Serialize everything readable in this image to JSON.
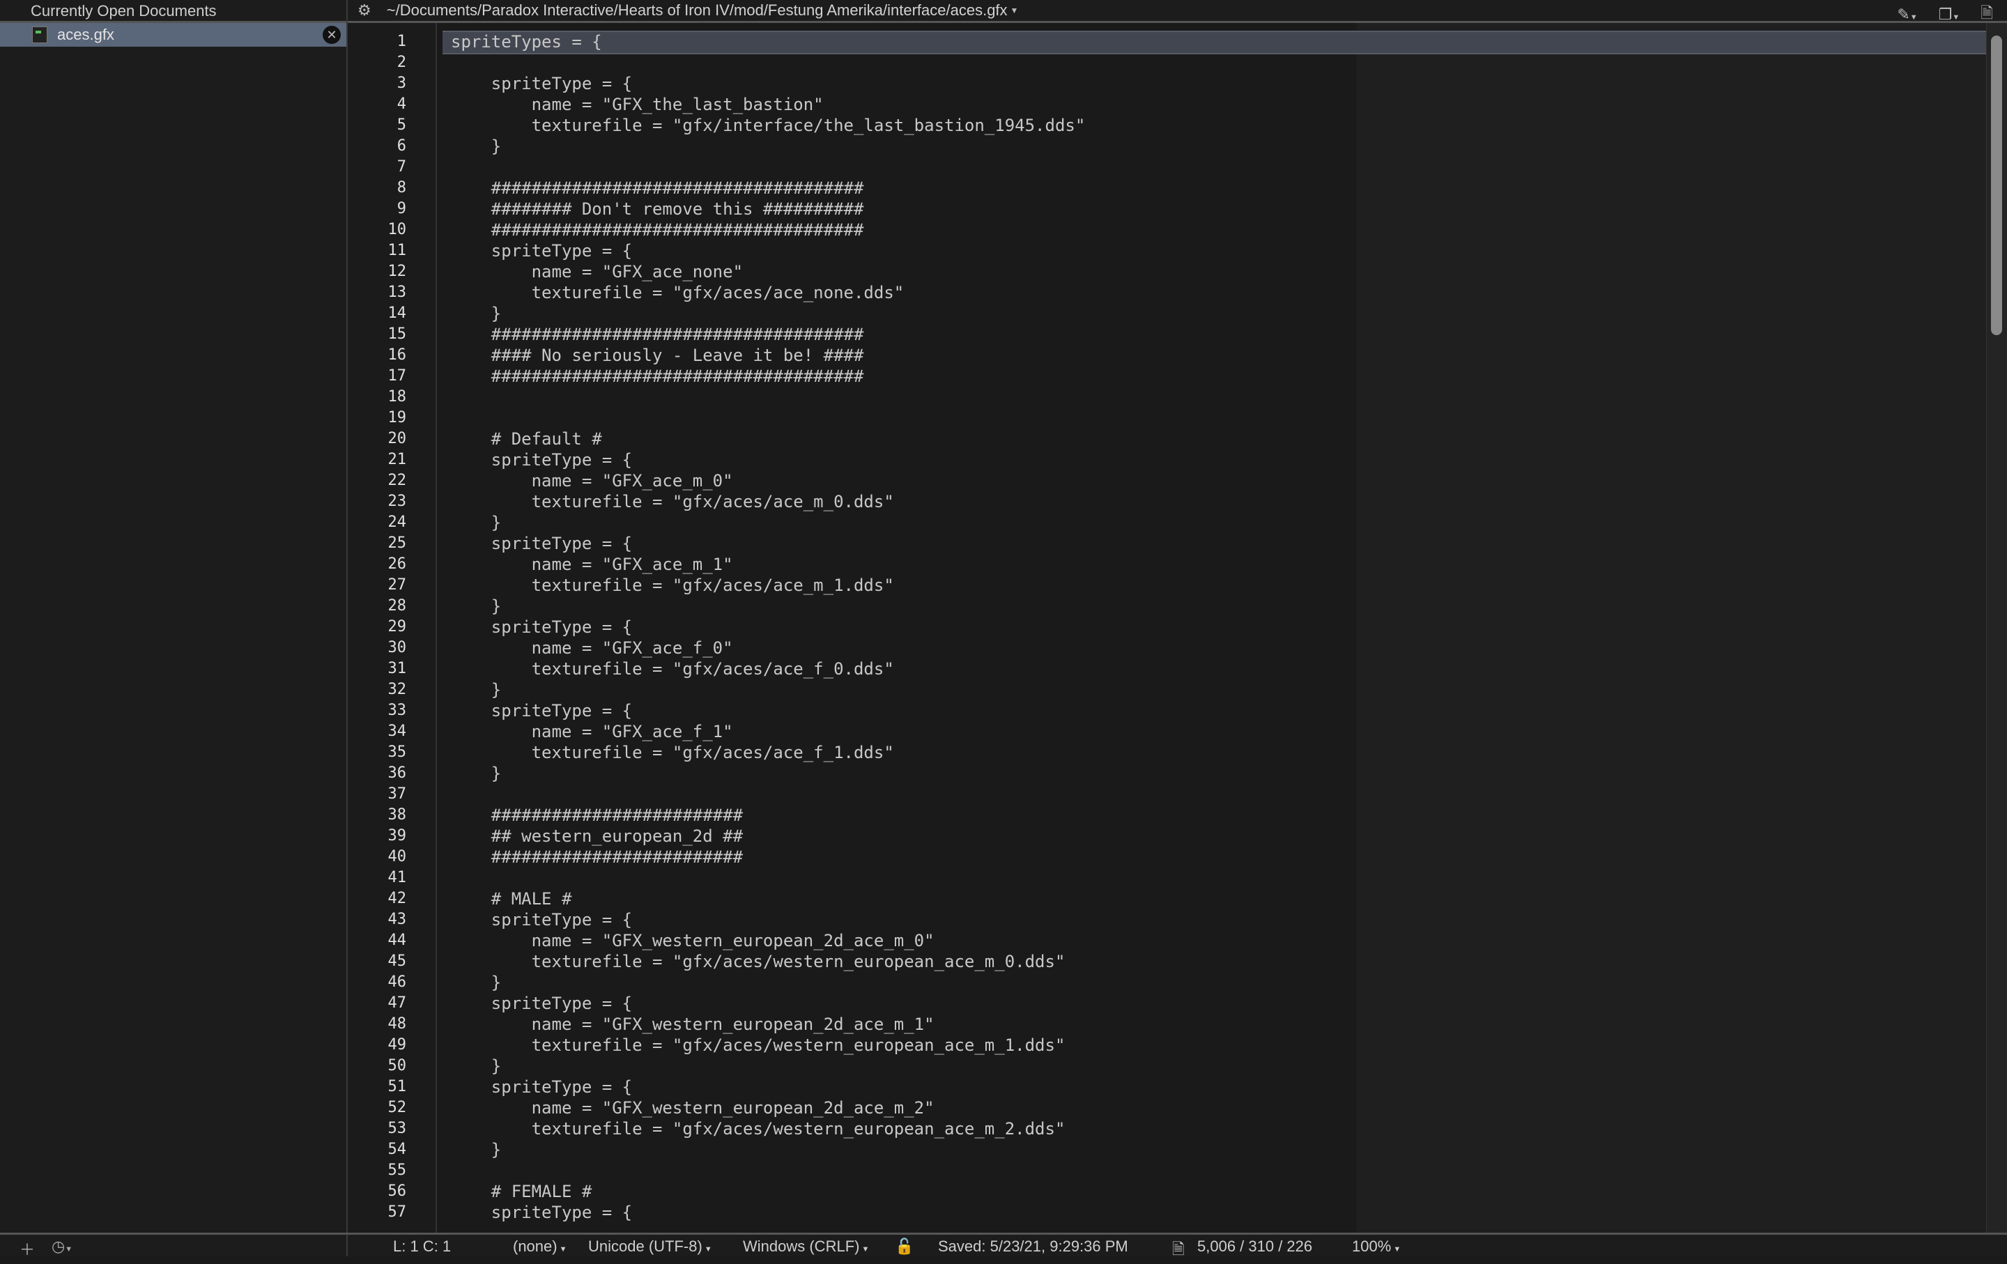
{
  "sidebar": {
    "title": "Currently Open Documents",
    "documents": [
      {
        "name": "aces.gfx",
        "selected": true
      }
    ],
    "add_icon": "plus-icon",
    "history_icon": "clock-icon"
  },
  "toolbar": {
    "path": "~/Documents/Paradox Interactive/Hearts of Iron IV/mod/Festung Amerika/interface/aces.gfx",
    "icons": [
      "gear-icon",
      "bookmark-icon",
      "copy-icon",
      "document-icon"
    ]
  },
  "editor": {
    "current_line": 1,
    "code_lines": [
      "spriteTypes = {",
      "",
      "    spriteType = {",
      "        name = \"GFX_the_last_bastion\"",
      "        texturefile = \"gfx/interface/the_last_bastion_1945.dds\"",
      "    }",
      "",
      "    #####################################",
      "    ######## Don't remove this ##########",
      "    #####################################",
      "    spriteType = {",
      "        name = \"GFX_ace_none\"",
      "        texturefile = \"gfx/aces/ace_none.dds\"",
      "    }",
      "    #####################################",
      "    #### No seriously - Leave it be! ####",
      "    #####################################",
      "",
      "",
      "    # Default #",
      "    spriteType = {",
      "        name = \"GFX_ace_m_0\"",
      "        texturefile = \"gfx/aces/ace_m_0.dds\"",
      "    }",
      "    spriteType = {",
      "        name = \"GFX_ace_m_1\"",
      "        texturefile = \"gfx/aces/ace_m_1.dds\"",
      "    }",
      "    spriteType = {",
      "        name = \"GFX_ace_f_0\"",
      "        texturefile = \"gfx/aces/ace_f_0.dds\"",
      "    }",
      "    spriteType = {",
      "        name = \"GFX_ace_f_1\"",
      "        texturefile = \"gfx/aces/ace_f_1.dds\"",
      "    }",
      "",
      "    #########################",
      "    ## western_european_2d ##",
      "    #########################",
      "",
      "    # MALE #",
      "    spriteType = {",
      "        name = \"GFX_western_european_2d_ace_m_0\"",
      "        texturefile = \"gfx/aces/western_european_ace_m_0.dds\"",
      "    }",
      "    spriteType = {",
      "        name = \"GFX_western_european_2d_ace_m_1\"",
      "        texturefile = \"gfx/aces/western_european_ace_m_1.dds\"",
      "    }",
      "    spriteType = {",
      "        name = \"GFX_western_european_2d_ace_m_2\"",
      "        texturefile = \"gfx/aces/western_european_ace_m_2.dds\"",
      "    }",
      "",
      "    # FEMALE #",
      "    spriteType = {"
    ]
  },
  "status": {
    "position": "L: 1 C: 1",
    "syntax": "(none)",
    "encoding": "Unicode (UTF-8)",
    "line_endings": "Windows (CRLF)",
    "saved": "Saved: 5/23/21, 9:29:36 PM",
    "counts": "5,006 / 310 / 226",
    "zoom": "100%"
  }
}
